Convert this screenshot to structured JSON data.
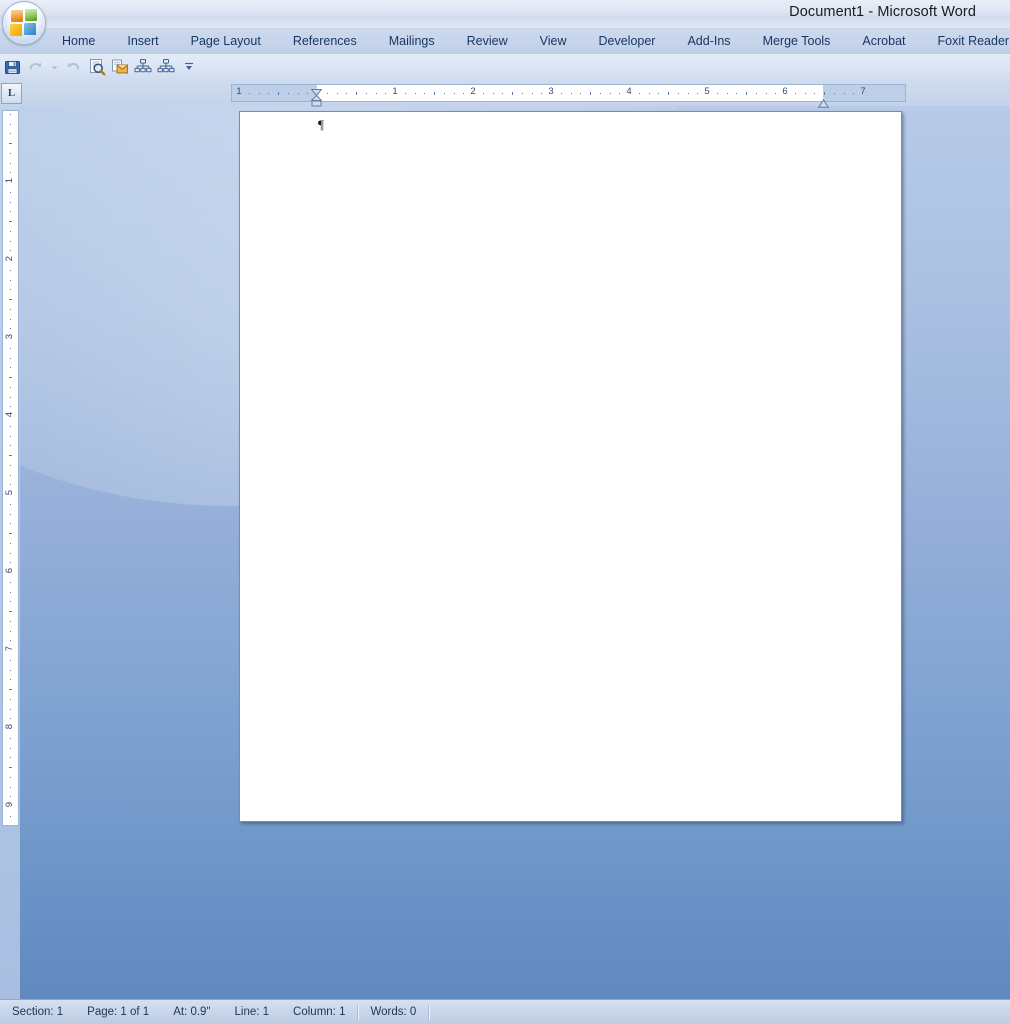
{
  "window": {
    "title": "Document1 - Microsoft Word",
    "app_name": "Microsoft Word",
    "document_name": "Document1"
  },
  "office_button": {
    "name": "office-orb",
    "label": "Office"
  },
  "ribbon": {
    "tabs": [
      {
        "label": "Home",
        "active": false
      },
      {
        "label": "Insert",
        "active": false
      },
      {
        "label": "Page Layout",
        "active": false
      },
      {
        "label": "References",
        "active": false
      },
      {
        "label": "Mailings",
        "active": false
      },
      {
        "label": "Review",
        "active": false
      },
      {
        "label": "View",
        "active": false
      },
      {
        "label": "Developer",
        "active": false
      },
      {
        "label": "Add-Ins",
        "active": false
      },
      {
        "label": "Merge Tools",
        "active": false
      },
      {
        "label": "Acrobat",
        "active": false
      },
      {
        "label": "Foxit Reader PDF",
        "active": false
      }
    ],
    "collapsed": true
  },
  "quick_access_toolbar": {
    "items": [
      {
        "icon": "save-icon",
        "label": "Save",
        "enabled": true
      },
      {
        "icon": "undo-icon",
        "label": "Undo",
        "enabled": false
      },
      {
        "icon": "chevron-down-icon",
        "label": "Undo History",
        "enabled": false
      },
      {
        "icon": "redo-icon",
        "label": "Redo",
        "enabled": false
      },
      {
        "icon": "print-preview-icon",
        "label": "Print Preview",
        "enabled": true
      },
      {
        "icon": "email-icon",
        "label": "E-mail",
        "enabled": true
      },
      {
        "icon": "org-chart-icon",
        "label": "Organization Chart",
        "enabled": true
      },
      {
        "icon": "org-chart-2-icon",
        "label": "Hierarchy",
        "enabled": true
      },
      {
        "icon": "customize-qat-icon",
        "label": "Customize Quick Access Toolbar",
        "enabled": true
      }
    ]
  },
  "ruler": {
    "tab_stop_selector": "L",
    "horizontal": {
      "unit": "inch",
      "labels": [
        "1",
        "1",
        "2",
        "3",
        "4",
        "5",
        "6",
        "7"
      ],
      "left_margin_inches": 1,
      "right_margin_inches": 1,
      "page_width_inches": 8.5
    },
    "vertical": {
      "unit": "inch",
      "labels": [
        "1",
        "2",
        "3",
        "4",
        "5",
        "6",
        "7",
        "8",
        "9"
      ]
    },
    "markers": {
      "first_line_indent": "first-line-indent-marker",
      "hanging_indent": "hanging-indent-marker",
      "left_indent": "left-indent-marker",
      "right_indent": "right-indent-marker"
    }
  },
  "document": {
    "paragraph_mark": "¶",
    "page_background": "#ffffff",
    "empty": true
  },
  "status_bar": {
    "items": [
      {
        "label": "Section: 1"
      },
      {
        "label": "Page: 1 of 1"
      },
      {
        "label": "At: 0.9\""
      },
      {
        "label": "Line: 1"
      },
      {
        "label": "Column: 1"
      },
      {
        "label": "Words: 0"
      }
    ]
  },
  "colors": {
    "titlebar_start": "#e9eef7",
    "tabrow": "#c7d5ec",
    "tab_text": "#17365d",
    "workspace_top": "#b7cbe8",
    "workspace_bottom": "#6089c0",
    "status_text": "#1d3557",
    "page_border": "#8a8a8a"
  }
}
